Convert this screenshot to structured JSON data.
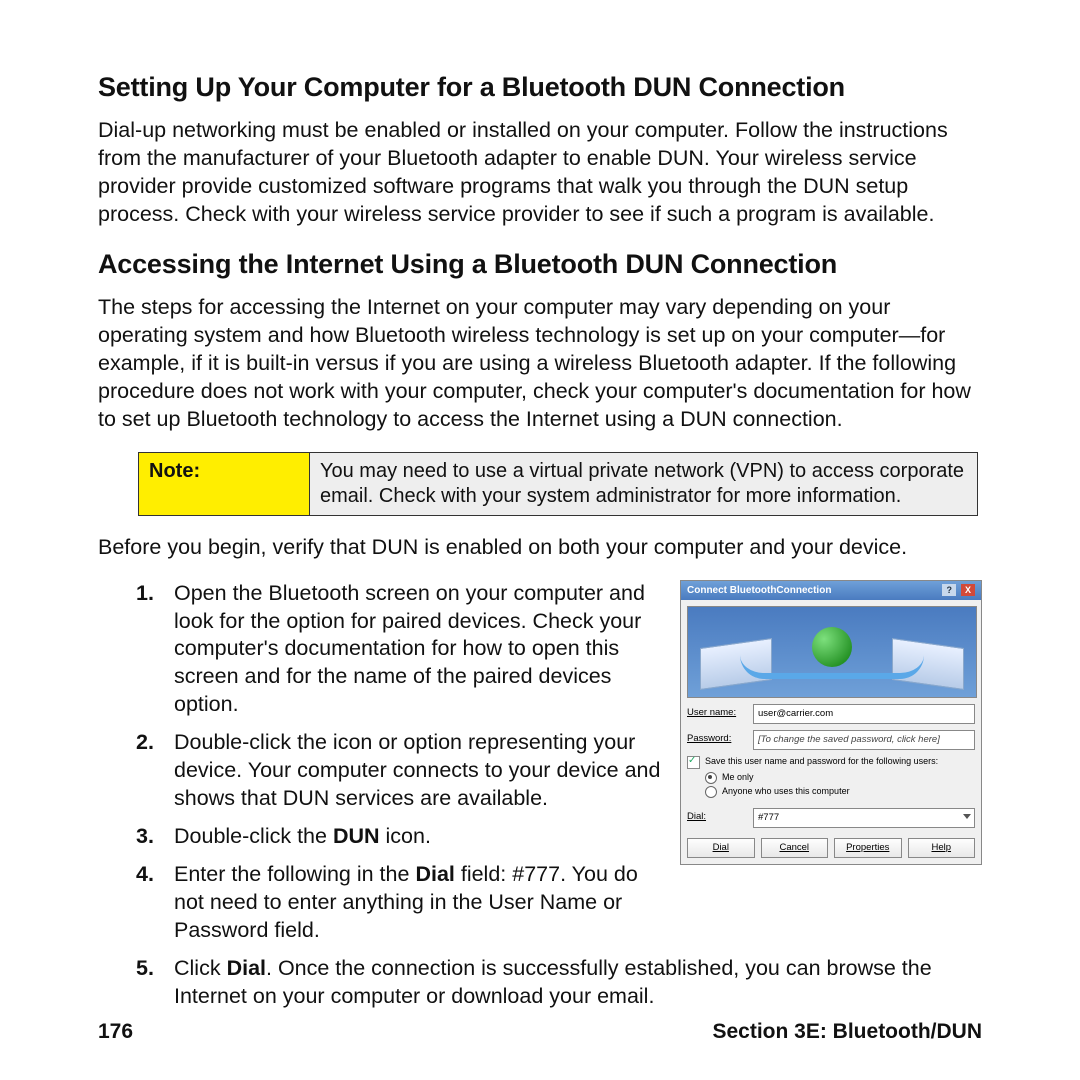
{
  "h1": "Setting Up Your Computer for a Bluetooth DUN Connection",
  "p1": "Dial-up networking must be enabled or installed on your computer. Follow the instructions from the manufacturer of your Bluetooth adapter to enable DUN. Your wireless service provider provide customized software programs that walk you through the DUN setup process. Check with your wireless service provider to see if such a program is available.",
  "h2": "Accessing the Internet Using a Bluetooth DUN Connection",
  "p2": "The steps for accessing the Internet on your computer may vary depending on your operating system and how Bluetooth wireless technology is set up on your computer—for example, if it is built-in versus if you are using a wireless Bluetooth adapter. If the following procedure does not work with your computer, check your computer's documentation for how to set up Bluetooth technology to access the Internet using a DUN connection.",
  "note_label": "Note:",
  "note_body": "You may need to use a virtual private network (VPN) to access corporate email. Check with your system administrator for more information.",
  "p_before": "Before you begin, verify that DUN is enabled on both your computer and your device.",
  "steps": {
    "s1": "Open the Bluetooth screen on your computer and look for the option for paired devices. Check your computer's documentation for how to open this screen and for the name of the paired devices option.",
    "s2": "Double-click the icon or option representing your device. Your computer connects to your device and shows that DUN services are available.",
    "s3_a": "Double-click the ",
    "s3_b": "DUN",
    "s3_c": " icon.",
    "s4_a": "Enter the following in the ",
    "s4_b": "Dial",
    "s4_c": " field: #777. You do not need to enter anything in the User Name or Password field.",
    "s5_a": "Click ",
    "s5_b": "Dial",
    "s5_c": ". Once the connection is successfully established, you can browse the Internet on your computer or download your email."
  },
  "dialog": {
    "title": "Connect BluetoothConnection",
    "user_lbl": "User name:",
    "user_val": "user@carrier.com",
    "pass_lbl": "Password:",
    "pass_val": "[To change the saved password, click here]",
    "save_lbl": "Save this user name and password for the following users:",
    "radio1": "Me only",
    "radio2": "Anyone who uses this computer",
    "dial_lbl": "Dial:",
    "dial_val": "#777",
    "btn_dial": "Dial",
    "btn_cancel": "Cancel",
    "btn_props": "Properties",
    "btn_help": "Help"
  },
  "footer": {
    "page": "176",
    "section": "Section 3E: Bluetooth/DUN"
  }
}
